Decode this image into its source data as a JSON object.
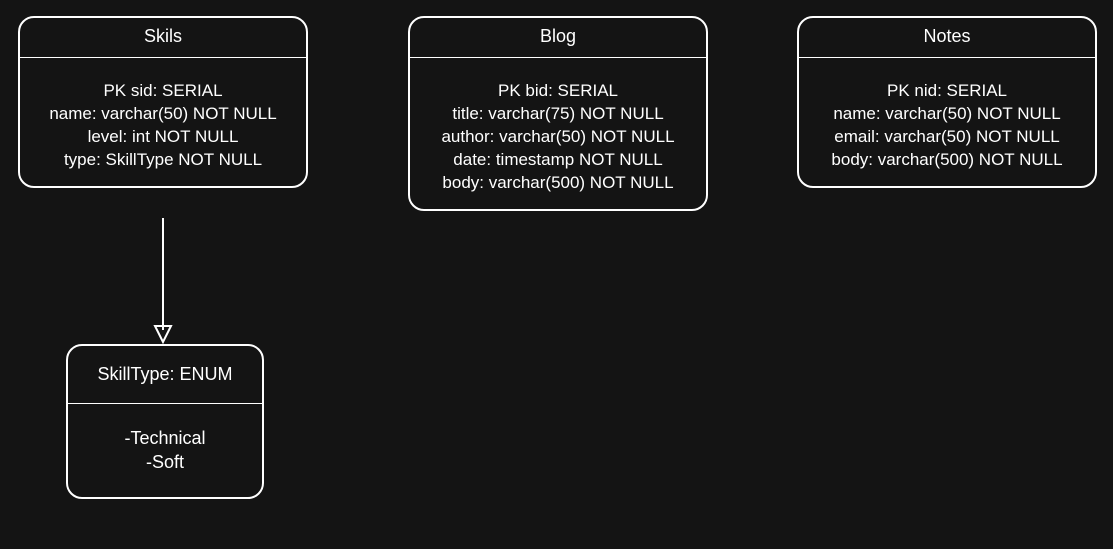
{
  "entities": {
    "skills": {
      "title": "Skils",
      "fields": [
        "PK sid: SERIAL",
        "name: varchar(50) NOT NULL",
        "level: int NOT NULL",
        "type: SkillType NOT NULL"
      ]
    },
    "blog": {
      "title": "Blog",
      "fields": [
        "PK bid: SERIAL",
        "title: varchar(75) NOT NULL",
        "author: varchar(50) NOT NULL",
        "date: timestamp NOT NULL",
        "body: varchar(500) NOT NULL"
      ]
    },
    "notes": {
      "title": "Notes",
      "fields": [
        "PK nid: SERIAL",
        "name: varchar(50) NOT NULL",
        "email: varchar(50) NOT NULL",
        "body: varchar(500) NOT NULL"
      ]
    }
  },
  "enum": {
    "skillType": {
      "title": "SkillType: ENUM",
      "values": [
        "-Technical",
        "-Soft"
      ]
    }
  }
}
